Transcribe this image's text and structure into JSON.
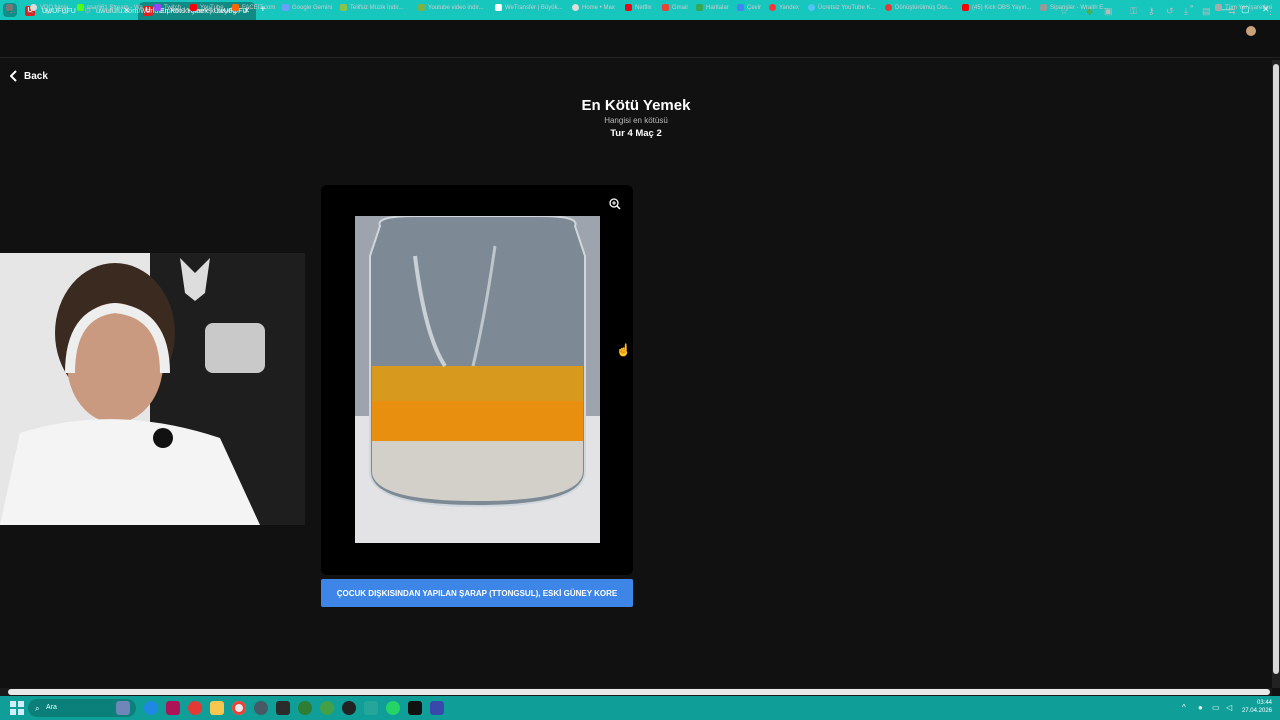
{
  "browser": {
    "tabs": [
      {
        "label": "UwUFUFU"
      },
      {
        "label": "En Kötü Yemek | UwUFUFU"
      }
    ],
    "url": "uwufufu.com/worldcup/en-kt-yemek-zeydg",
    "bookmarks": [
      "VDO.Ninja",
      "ssarli61 Stream - Wa...",
      "Twitch",
      "YouTube",
      "FACEIT.com",
      "Google Gemini",
      "Telifsiz Müzik İndir...",
      "Youtube video indir...",
      "WeTransfer | Büyük...",
      "Home • Max",
      "Netflix",
      "Gmail",
      "Haritalar",
      "Çevir",
      "Yandex",
      "Ücretsiz YouTube K...",
      "Dönüştürülmüş Dos...",
      "(45) Kick OBS Yayın...",
      "Siparişler - Wraith E..."
    ],
    "all_bookmarks": "Tüm Yer İşaretleri"
  },
  "page": {
    "back_label": "Back",
    "title": "En Kötü Yemek",
    "subtitle": "Hangisi en kötüsü",
    "round": "Tur 4 Maç 2",
    "choice_label": "ÇOCUK DIŞKISINDAN YAPILAN ŞARAP (TTONGSUL), ESKİ GÜNEY KORE"
  },
  "taskbar": {
    "search_placeholder": "Ara",
    "time": "03:44",
    "date": "27.04.2026"
  },
  "colors": {
    "accent": "#3d86e8",
    "tabbar": "#17c6bd",
    "taskbar": "#0f9e98",
    "background": "#111111"
  }
}
